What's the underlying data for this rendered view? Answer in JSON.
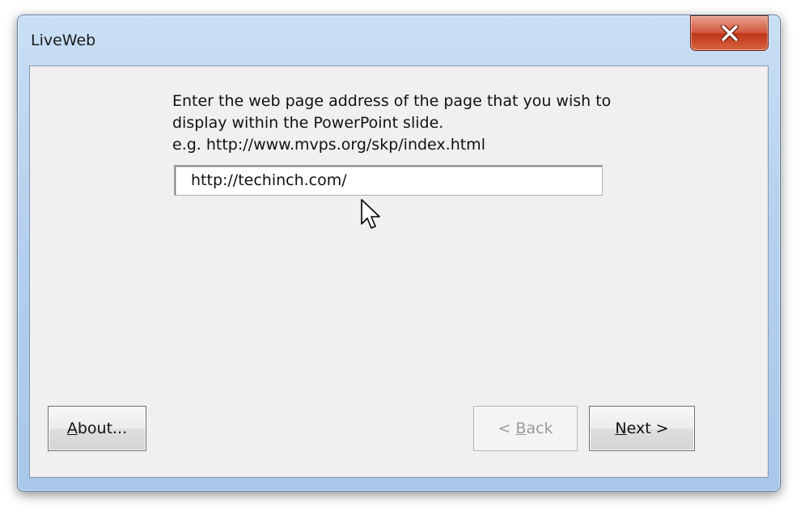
{
  "window": {
    "title": "LiveWeb",
    "close_icon": "close-x-icon"
  },
  "prompt": {
    "line1": "Enter the web page address of the page that you wish to",
    "line2": "display within the PowerPoint slide.",
    "line3": "e.g. http://www.mvps.org/skp/index.html"
  },
  "url_field": {
    "value": "http://techinch.com/"
  },
  "buttons": {
    "about": {
      "mnemonic": "A",
      "rest": "bout..."
    },
    "back": {
      "prefix": "< ",
      "mnemonic": "B",
      "rest": "ack"
    },
    "next": {
      "mnemonic": "N",
      "rest": "ext >"
    }
  },
  "colors": {
    "close_red": "#c9401f",
    "title_bar": "#b9d3ef",
    "client_bg": "#f0f0f0"
  }
}
